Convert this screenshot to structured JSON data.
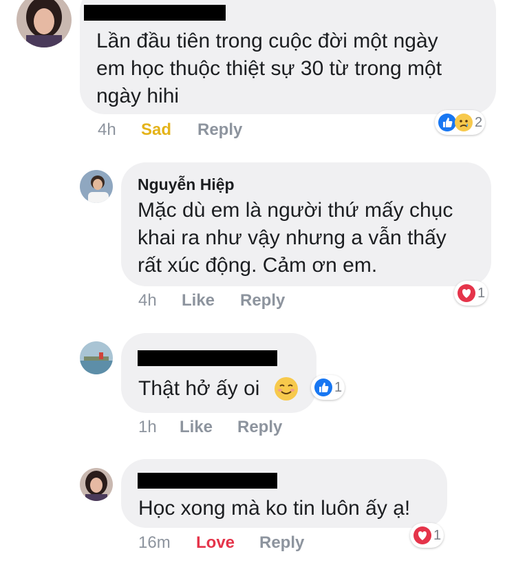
{
  "comments": [
    {
      "text_lines": [
        "Lần đầu tiên trong cuộc đời một ngày",
        "em học thuộc thiệt sự 30 từ trong một",
        "ngày hihi"
      ],
      "time": "4h",
      "reaction_label": "Sad",
      "reply_label": "Reply",
      "reaction_count": "2",
      "reaction_icons": [
        "like-icon",
        "sad-icon"
      ]
    },
    {
      "name": "Nguyễn Hiệp",
      "text_lines": [
        "Mặc dù em là người thứ mấy chục",
        "khai ra như vậy nhưng a vẫn thấy",
        "rất xúc động. Cảm ơn em."
      ],
      "time": "4h",
      "like_label": "Like",
      "reply_label": "Reply",
      "reaction_count": "1",
      "reaction_icons": [
        "love-icon"
      ]
    },
    {
      "text": "Thật hở ấy oi",
      "time": "1h",
      "like_label": "Like",
      "reply_label": "Reply",
      "reaction_count": "1",
      "reaction_icons": [
        "like-icon"
      ]
    },
    {
      "text": "Học xong mà ko tin luôn ấy ạ!",
      "time": "16m",
      "reaction_label": "Love",
      "reply_label": "Reply",
      "reaction_count": "1",
      "reaction_icons": [
        "love-icon"
      ]
    }
  ],
  "colors": {
    "bubble": "#f0f0f2",
    "meta_text": "#8d949e",
    "sad": "#e4b31a",
    "love": "#e5344a",
    "like": "#1877f2"
  }
}
